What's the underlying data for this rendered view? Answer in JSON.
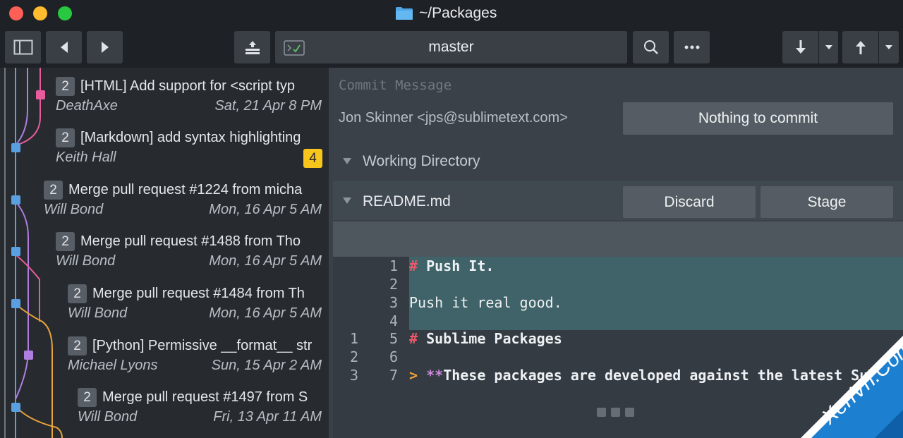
{
  "window": {
    "title": "~/Packages"
  },
  "toolbar": {
    "branch": "master"
  },
  "commits": [
    {
      "count": "2",
      "subject": "[HTML] Add support for <script typ",
      "author": "DeathAxe",
      "date": "Sat, 21 Apr 8 PM"
    },
    {
      "count": "2",
      "subject": "[Markdown] add syntax highlighting",
      "author": "Keith Hall",
      "date": ""
    },
    {
      "count": "2",
      "subject": "Merge pull request #1224 from micha",
      "author": "Will Bond",
      "date": "Mon, 16 Apr 5 AM"
    },
    {
      "count": "2",
      "subject": "Merge pull request #1488 from Tho",
      "author": "Will Bond",
      "date": "Mon, 16 Apr 5 AM"
    },
    {
      "count": "2",
      "subject": "Merge pull request #1484 from Th",
      "author": "Will Bond",
      "date": "Mon, 16 Apr 5 AM"
    },
    {
      "count": "2",
      "subject": "[Python] Permissive __format__ str",
      "author": "Michael Lyons",
      "date": "Sun, 15 Apr 2 AM"
    },
    {
      "count": "2",
      "subject": "Merge pull request #1497 from S",
      "author": "Will Bond",
      "date": "Fri, 13 Apr 11 AM"
    }
  ],
  "commit_badge": "4",
  "commit_panel": {
    "message_placeholder": "Commit Message",
    "author": "Jon Skinner <jps@sublimetext.com>",
    "nothing_button": "Nothing to commit",
    "working_directory": "Working Directory",
    "file": "README.md",
    "discard": "Discard",
    "stage": "Stage"
  },
  "diff": {
    "lines": [
      {
        "old": "",
        "new": "1",
        "marker": "#",
        "text": " Push It.",
        "added": true,
        "bold": true
      },
      {
        "old": "",
        "new": "2",
        "marker": "",
        "text": "",
        "added": true,
        "bold": false
      },
      {
        "old": "",
        "new": "3",
        "marker": "",
        "text": "Push it real good.",
        "added": true,
        "bold": false
      },
      {
        "old": "",
        "new": "4",
        "marker": "",
        "text": "",
        "added": true,
        "bold": false
      },
      {
        "old": "1",
        "new": "5",
        "marker": "#",
        "text": " Sublime Packages",
        "added": false,
        "bold": true
      },
      {
        "old": "2",
        "new": "6",
        "marker": "",
        "text": "",
        "added": false,
        "bold": false
      },
      {
        "old": "3",
        "new": "7",
        "marker": ">",
        "text": "These packages are developed against the latest Subli",
        "added": false,
        "bold": true,
        "stars": "**"
      }
    ]
  },
  "watermark": {
    "text": "XenVn.Com"
  },
  "colors": {
    "accent_pink": "#e85b9c",
    "accent_blue": "#5aa0e0",
    "accent_purple": "#b07ee0",
    "accent_orange": "#e8a33a",
    "badge_yellow": "#f7c51b"
  }
}
